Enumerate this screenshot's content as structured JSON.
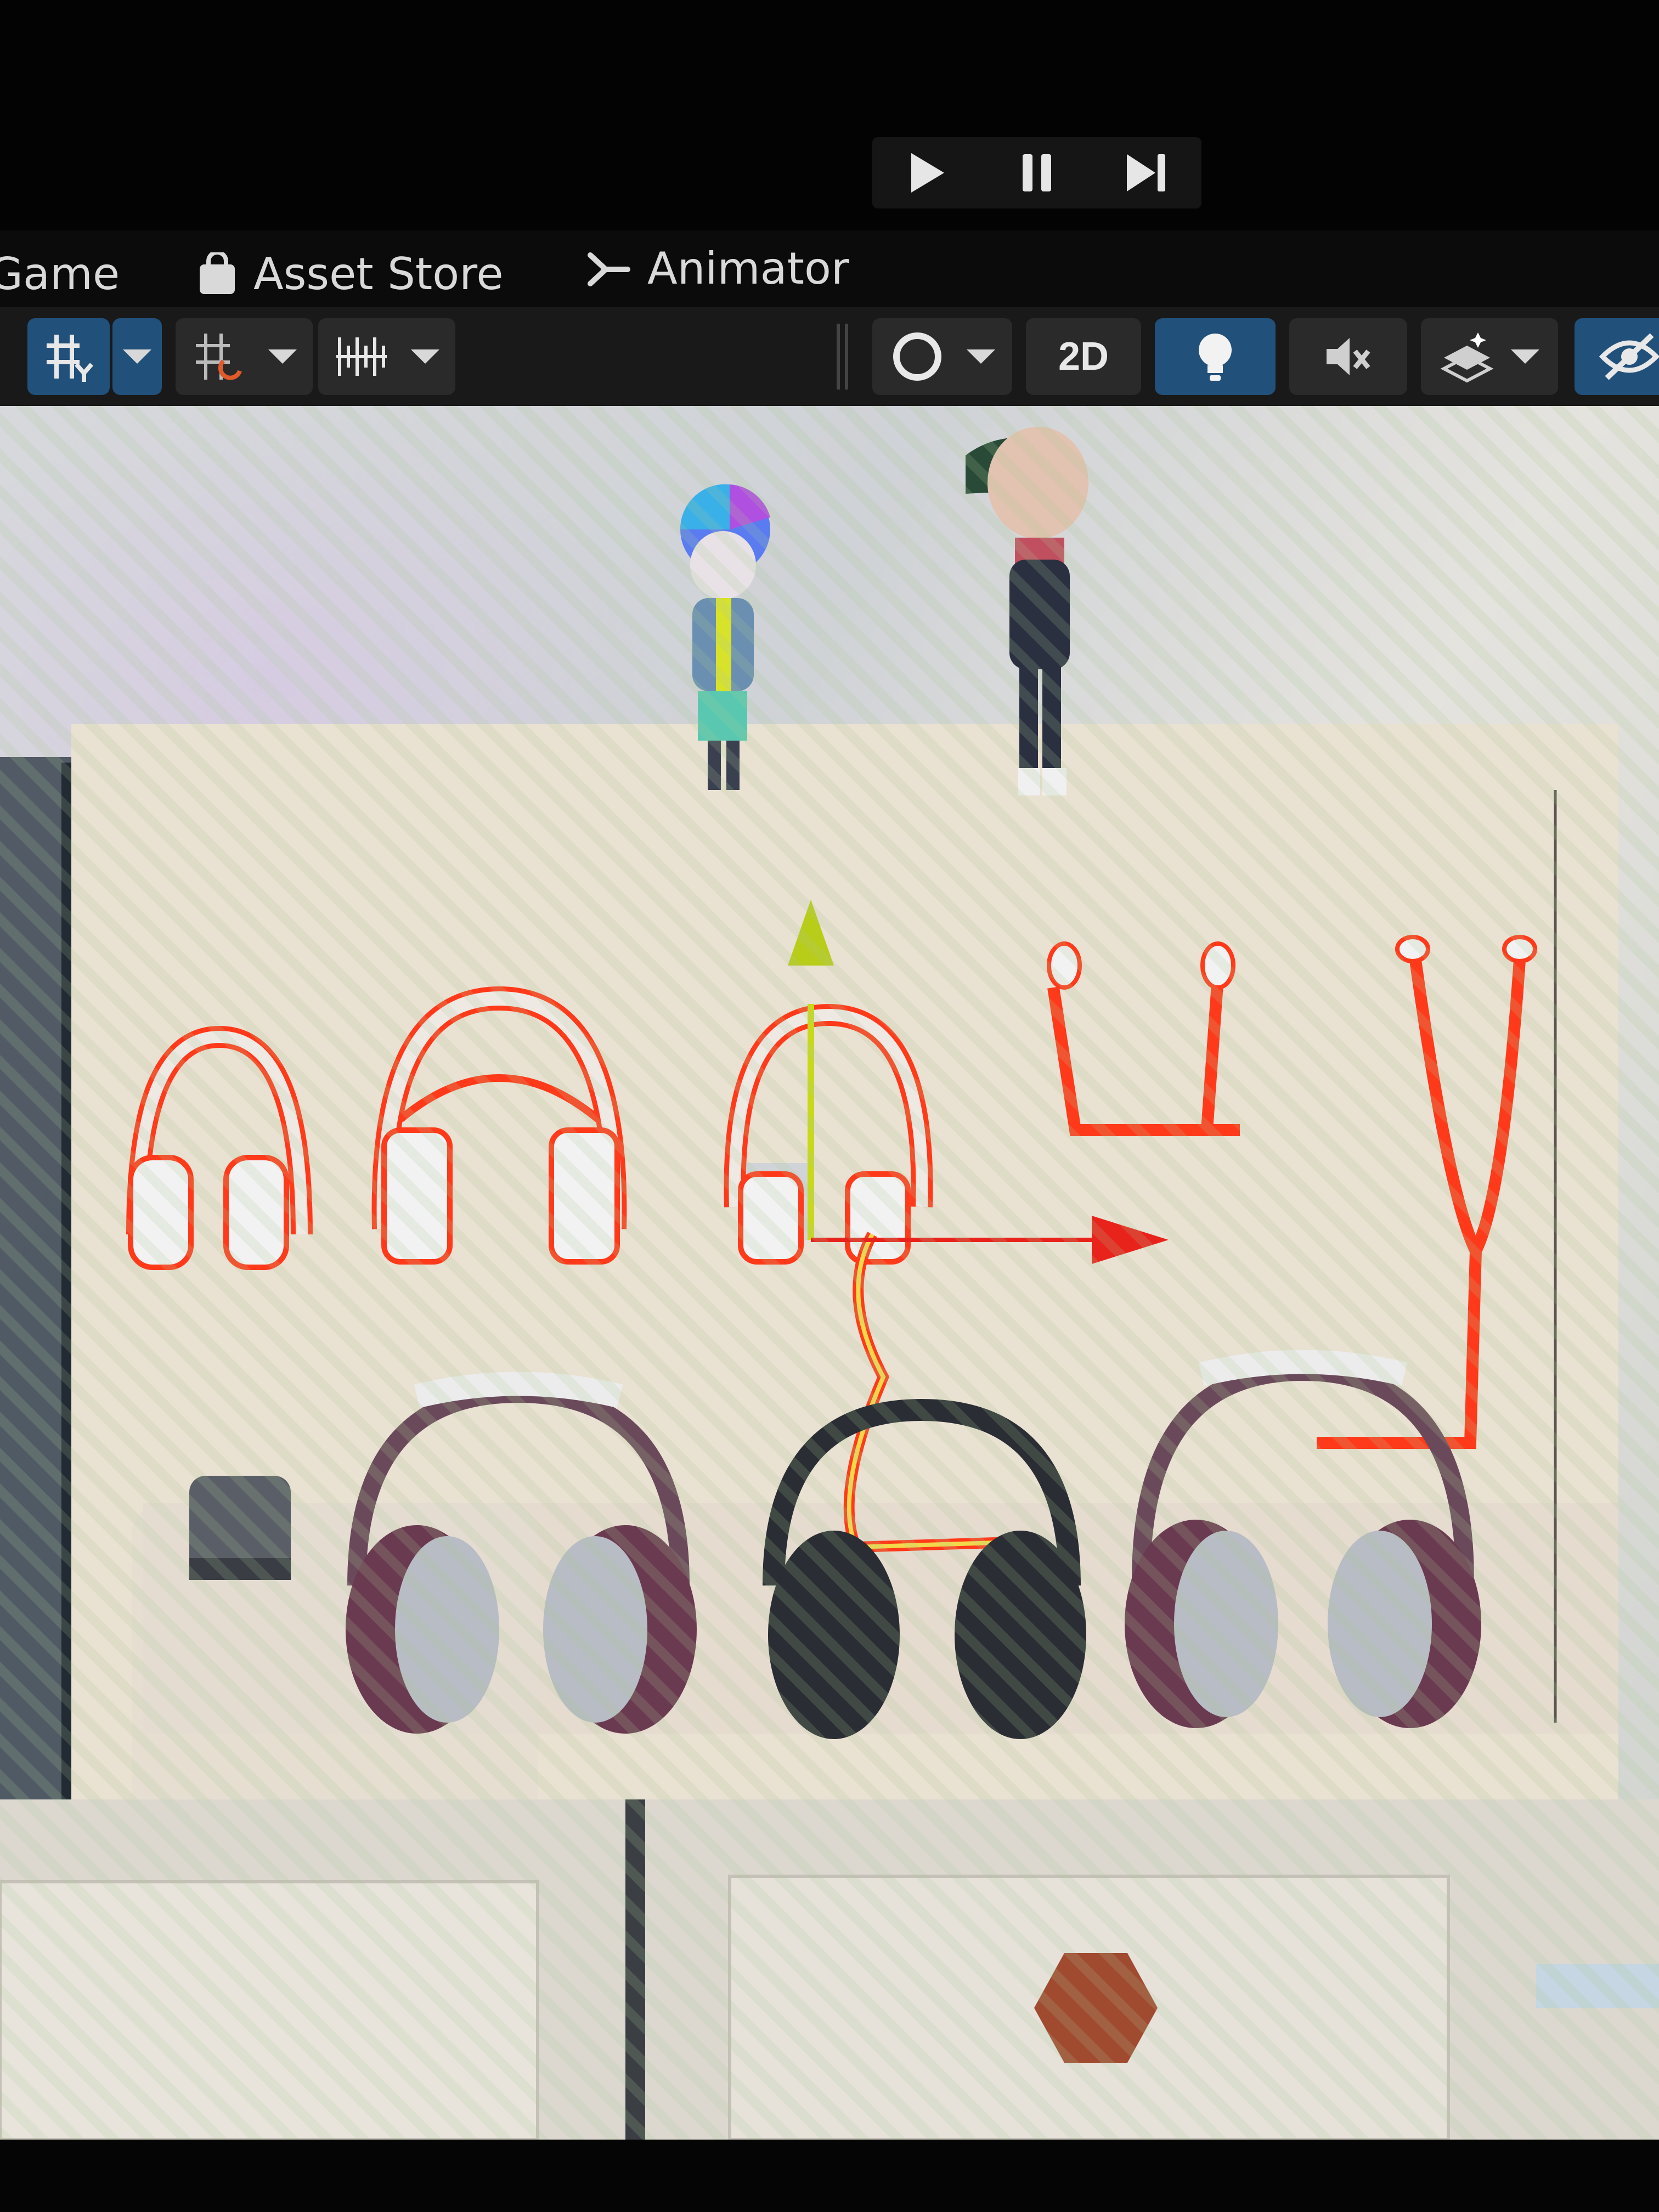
{
  "play_controls": {
    "play_icon": "play-icon",
    "pause_icon": "pause-icon",
    "step_icon": "step-forward-icon"
  },
  "tabs": [
    {
      "label": "Game",
      "icon": "gamepad-icon"
    },
    {
      "label": "Asset Store",
      "icon": "shopping-bag-icon"
    },
    {
      "label": "Animator",
      "icon": "animator-icon"
    }
  ],
  "scene_toolbar": {
    "view_2d_label": "2D",
    "tools": [
      "grid-snap-icon",
      "snap-increment-icon",
      "ruler-icon"
    ],
    "shading_icon": "shading-mode-icon",
    "lighting_icon": "lightbulb-icon",
    "audio_icon": "audio-mute-icon",
    "effects_icon": "effects-icon",
    "visibility_icon": "hidden-eye-icon"
  },
  "colors": {
    "accent": "#21507a",
    "outline": "#ff3a1a",
    "gizmo_x": "#e8231c",
    "gizmo_y": "#c8d81a"
  }
}
